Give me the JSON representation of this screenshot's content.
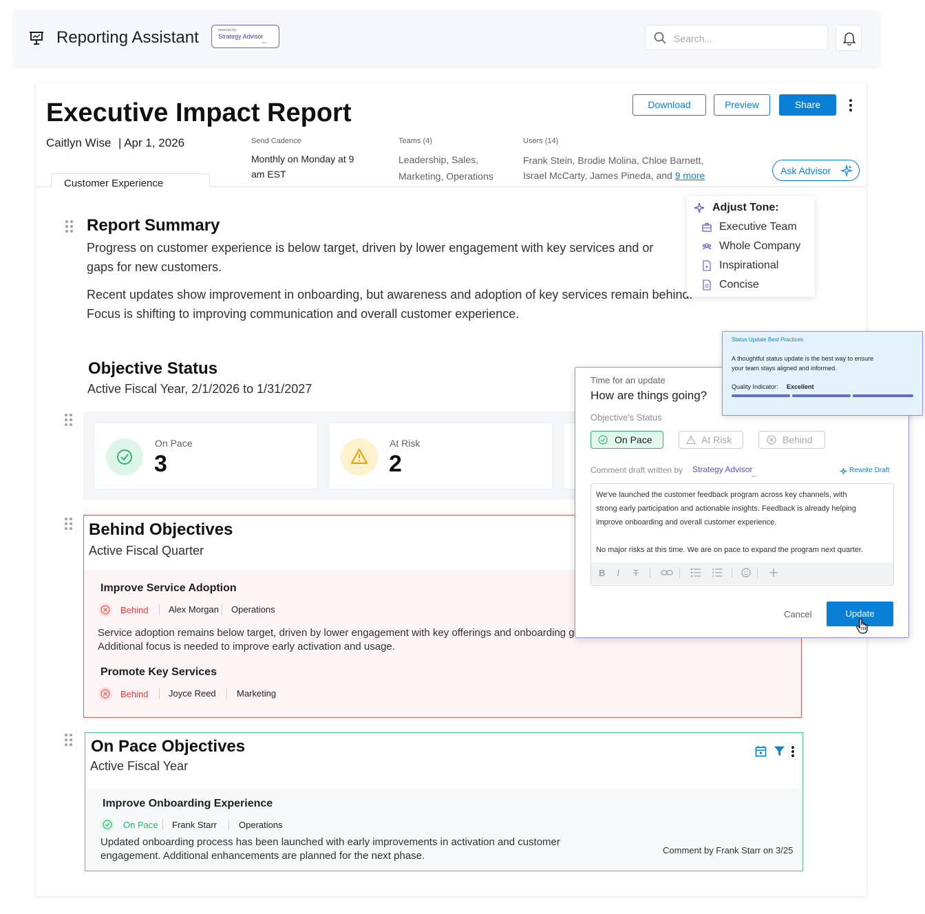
{
  "header": {
    "app_title": "Reporting Assistant",
    "badge": {
      "powered_by": "powered by",
      "product": "Strategy Advisor",
      "beta": "BETA"
    },
    "search_placeholder": "Search..."
  },
  "report": {
    "title": "Executive Impact Report",
    "author": "Caitlyn Wise",
    "date": "| Apr 1, 2026",
    "actions": {
      "download": "Download",
      "preview": "Preview",
      "share": "Share"
    },
    "send_cadence": {
      "label": "Send Cadence",
      "value_line1": "Monthly on Monday at 9",
      "value_line2": "am EST"
    },
    "teams": {
      "label": "Teams (4)",
      "value_line1": "Leadership, Sales,",
      "value_line2": "Marketing, Operations"
    },
    "users": {
      "label": "Users (14)",
      "value_line1": "Frank Stein, Brodie Molina, Chloe Barnett,",
      "value_line2": "Israel McCarty, James Pineda, and",
      "more_link": "9 more"
    },
    "ask_advisor": "Ask Advisor",
    "tab": "Customer Experience"
  },
  "summary": {
    "title": "Report Summary",
    "para1_line1": "Progress on customer experience is below target, driven by lower engagement with key services and or",
    "para1_line2": "gaps for new customers.",
    "para2_line1": "Recent updates show improvement in onboarding, but awareness and adoption of key services remain behind.",
    "para2_line2": "Focus is shifting to improving communication and overall customer experience."
  },
  "adjust_tone": {
    "title": "Adjust Tone:",
    "items": [
      "Executive Team",
      "Whole Company",
      "Inspirational",
      "Concise"
    ]
  },
  "objective_status": {
    "title": "Objective Status",
    "subtitle": "Active Fiscal Year, 2/1/2026 to 1/31/2027",
    "stats": [
      {
        "label": "On Pace",
        "value": "3"
      },
      {
        "label": "At Risk",
        "value": "2"
      }
    ]
  },
  "behind": {
    "title": "Behind Objectives",
    "subtitle": "Active Fiscal Quarter",
    "objectives": [
      {
        "name": "Improve Service Adoption",
        "status": "Behind",
        "owner": "Alex Morgan",
        "team": "Operations",
        "comment_line1": "Service adoption remains below target, driven by lower engagement with key offerings and onboarding gap",
        "comment_line2": "Additional focus is needed to improve early activation and usage."
      },
      {
        "name": "Promote Key Services",
        "status": "Behind",
        "owner": "Joyce Reed",
        "team": "Marketing"
      }
    ]
  },
  "on_pace": {
    "title": "On Pace Objectives",
    "subtitle": "Active Fiscal Year",
    "objectives": [
      {
        "name": "Improve Onboarding Experience",
        "status": "On Pace",
        "owner": "Frank Starr",
        "team": "Operations",
        "comment_line1": "Updated onboarding process has been launched with early improvements in activation and customer",
        "comment_line2": "engagement. Additional enhancements are planned for the next phase.",
        "comment_by": "Comment by Frank Starr on 3/25"
      }
    ]
  },
  "best_practices": {
    "title": "Status Update Best Practices",
    "body_line1": "A thoughtful status update is the best way to ensure",
    "body_line2": "your team stays aligned and informed.",
    "quality_label": "Quality Indicator:",
    "quality_value": "Excellent",
    "quality_level": 1.0
  },
  "update_dialog": {
    "eyebrow": "Time for an update",
    "title": "How are things going?",
    "status_label": "Objective's Status",
    "options": [
      "On Pace",
      "At Risk",
      "Behind"
    ],
    "selected": "On Pace",
    "draft_label": "Comment draft written by",
    "draft_brand": "Strategy Advisor",
    "beta": "BETA",
    "rewrite": "Rewrite Draft",
    "draft_p1_line1": "We've launched the customer feedback program across key channels, with",
    "draft_p1_line2": "strong early participation and actionable insights. Feedback is already helping",
    "draft_p1_line3": "improve onboarding and overall customer experience.",
    "draft_p2": "No major risks at this time. We are on pace to expand the program next quarter.",
    "cancel": "Cancel",
    "update": "Update"
  },
  "colors": {
    "accent": "#0a7fd6",
    "behind": "#e45a5a",
    "on_pace": "#2fb66e",
    "at_risk": "#f2b21b",
    "advisor": "#7a5bd6"
  }
}
